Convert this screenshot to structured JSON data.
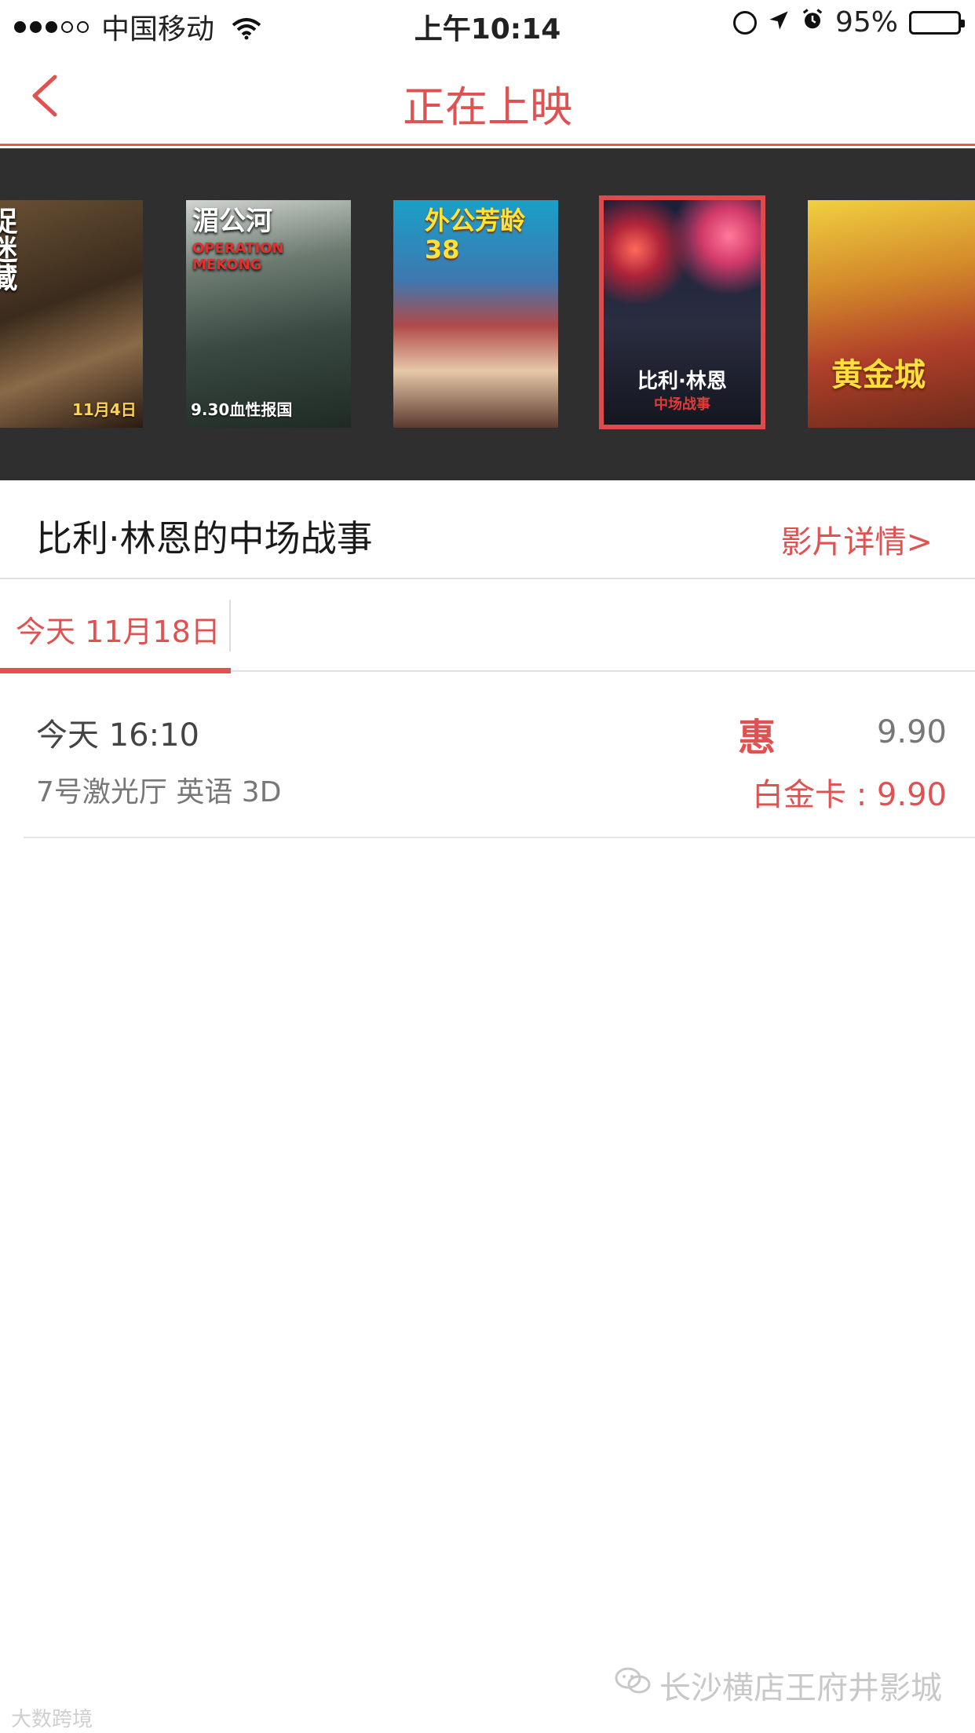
{
  "status_bar": {
    "carrier": "中国移动",
    "time": "上午10:14",
    "battery": "95%"
  },
  "nav": {
    "title": "正在上映"
  },
  "posters": [
    {
      "title": "捉迷藏",
      "note": "11月4日"
    },
    {
      "title": "湄公河",
      "subtitle": "OPERATION MEKONG",
      "note": "9.30血性报国"
    },
    {
      "title": "外公芳龄38",
      "note": ""
    },
    {
      "title": "比利·林恩",
      "subtitle": "中场战事",
      "selected": true
    },
    {
      "title": "黄金城",
      "note": ""
    }
  ],
  "movie": {
    "title": "比利·林恩的中场战事",
    "detail_link": "影片详情>"
  },
  "dates": [
    {
      "label": "今天 11月18日",
      "active": true
    }
  ],
  "showtimes": [
    {
      "time": "今天 16:10",
      "hall": "7号激光厅 英语 3D",
      "badge": "惠",
      "price": "9.90",
      "card_price": "白金卡 : 9.90"
    }
  ],
  "watermark": {
    "right": "长沙横店王府井影城",
    "left": "大数跨境"
  },
  "colors": {
    "accent": "#e05151",
    "strip_bg": "#2f2f2f"
  }
}
